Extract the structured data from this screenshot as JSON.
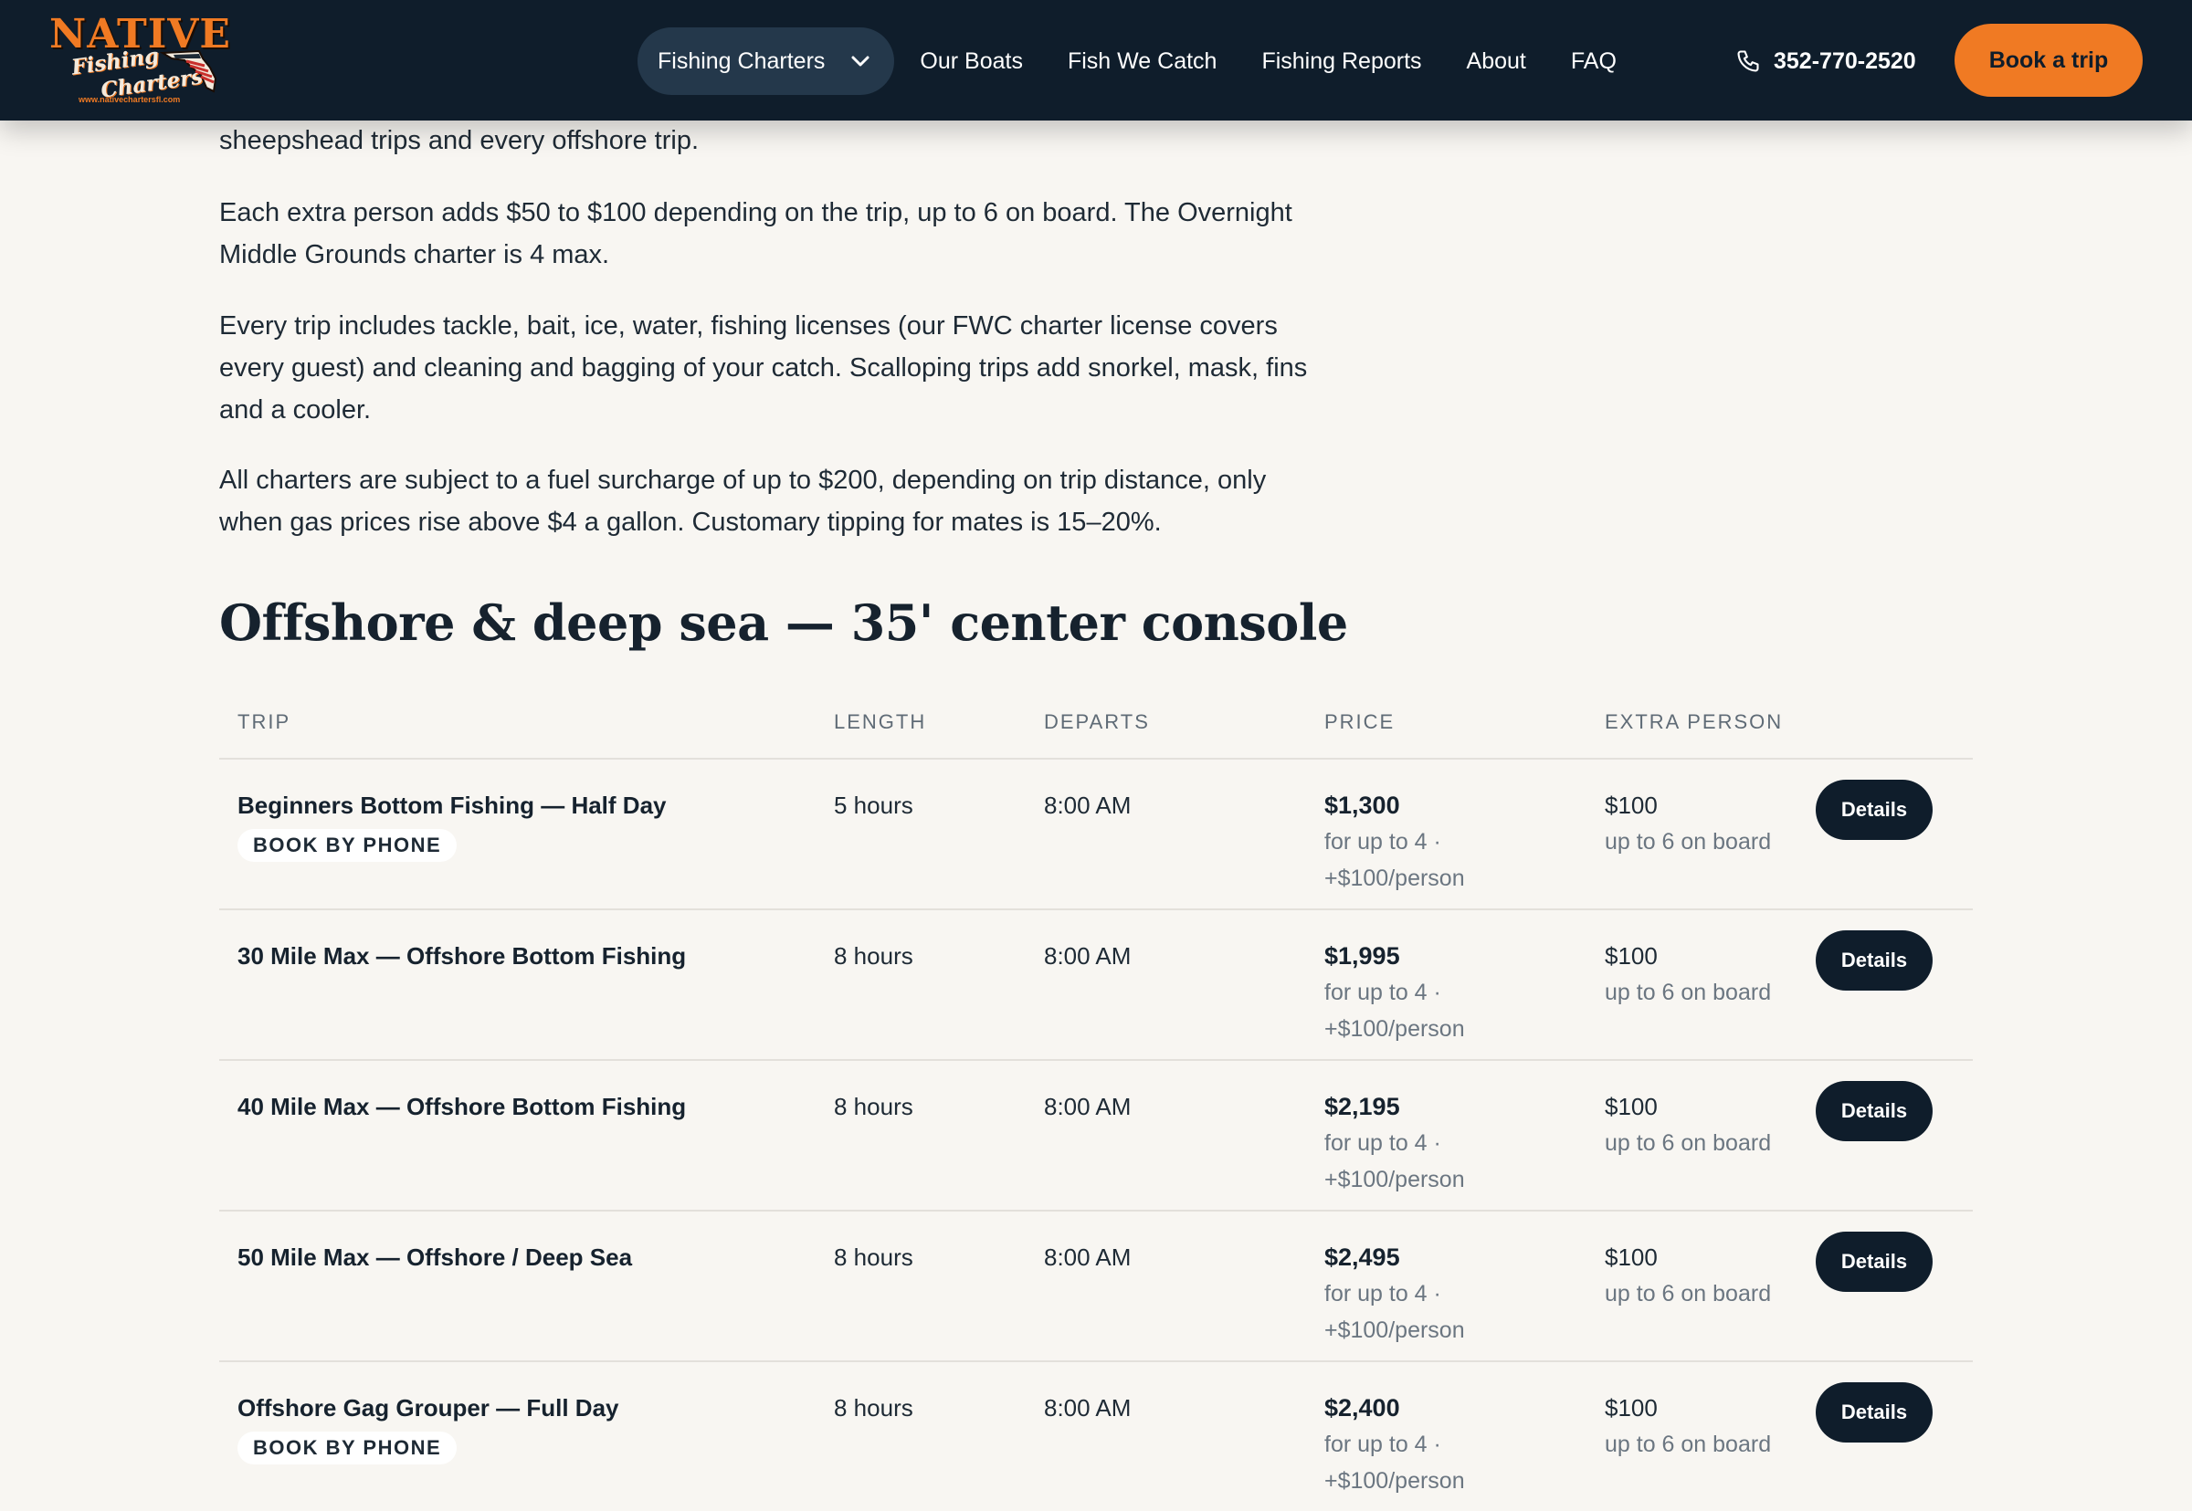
{
  "header": {
    "logo": {
      "main": "NATIVE",
      "sub1": "Fishing",
      "sub2": "Charters",
      "url": "www.nativechartersfl.com"
    },
    "nav": [
      {
        "label": "Fishing Charters",
        "has_dropdown": true
      },
      {
        "label": "Our Boats"
      },
      {
        "label": "Fish We Catch"
      },
      {
        "label": "Fishing Reports"
      },
      {
        "label": "About"
      },
      {
        "label": "FAQ"
      }
    ],
    "phone": "352-770-2520",
    "book_button": "Book a trip"
  },
  "content": {
    "paragraphs": [
      "sheepshead trips and every offshore trip.",
      "Each extra person adds $50 to $100 depending on the trip, up to 6 on board. The Overnight Middle Grounds charter is 4 max.",
      "Every trip includes tackle, bait, ice, water, fishing licenses (our FWC charter license covers every guest) and cleaning and bagging of your catch. Scalloping trips add snorkel, mask, fins and a cooler.",
      "All charters are subject to a fuel surcharge of up to $200, depending on trip distance, only when gas prices rise above $4 a gallon. Customary tipping for mates is 15–20%."
    ],
    "section_title": "Offshore & deep sea — 35' center console"
  },
  "table": {
    "headers": {
      "trip": "TRIP",
      "length": "LENGTH",
      "departs": "DEPARTS",
      "price": "PRICE",
      "extra": "EXTRA PERSON"
    },
    "rows": [
      {
        "trip": "Beginners Bottom Fishing — Half Day",
        "badge": "BOOK BY PHONE",
        "length": "5 hours",
        "departs": "8:00 AM",
        "price": "$1,300",
        "price_note1": "for up to 4 ·",
        "price_note2": "+$100/person",
        "extra": "$100",
        "extra_note": "up to 6 on board",
        "button": "Details"
      },
      {
        "trip": "30 Mile Max — Offshore Bottom Fishing",
        "badge": "",
        "length": "8 hours",
        "departs": "8:00 AM",
        "price": "$1,995",
        "price_note1": "for up to 4 ·",
        "price_note2": "+$100/person",
        "extra": "$100",
        "extra_note": "up to 6 on board",
        "button": "Details"
      },
      {
        "trip": "40 Mile Max — Offshore Bottom Fishing",
        "badge": "",
        "length": "8 hours",
        "departs": "8:00 AM",
        "price": "$2,195",
        "price_note1": "for up to 4 ·",
        "price_note2": "+$100/person",
        "extra": "$100",
        "extra_note": "up to 6 on board",
        "button": "Details"
      },
      {
        "trip": "50 Mile Max — Offshore / Deep Sea",
        "badge": "",
        "length": "8 hours",
        "departs": "8:00 AM",
        "price": "$2,495",
        "price_note1": "for up to 4 ·",
        "price_note2": "+$100/person",
        "extra": "$100",
        "extra_note": "up to 6 on board",
        "button": "Details"
      },
      {
        "trip": "Offshore Gag Grouper — Full Day",
        "badge": "BOOK BY PHONE",
        "length": "8 hours",
        "departs": "8:00 AM",
        "price": "$2,400",
        "price_note1": "for up to 4 ·",
        "price_note2": "+$100/person",
        "extra": "$100",
        "extra_note": "up to 6 on board",
        "button": "Details"
      }
    ]
  },
  "colors": {
    "header_bg": "#0f1d2b",
    "accent": "#f07a23",
    "page_bg": "#f8f6f2"
  },
  "icons": {
    "chevron": "chevron-down-icon",
    "phone": "phone-icon"
  }
}
